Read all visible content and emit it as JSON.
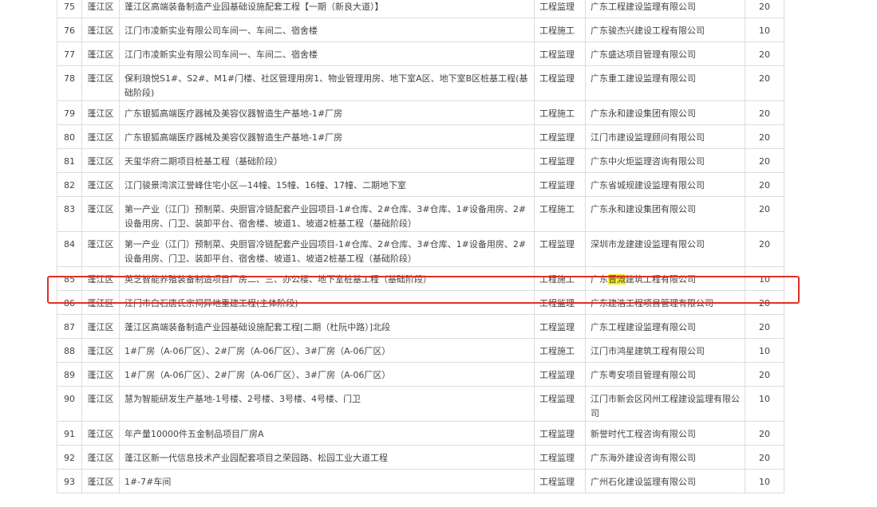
{
  "rows": [
    {
      "no": "75",
      "district": "蓬江区",
      "project": "蓬江区高端装备制造产业园基础设施配套工程【一期（新良大道）】",
      "type": "工程监理",
      "company": "广东工程建设监理有限公司",
      "score": "20"
    },
    {
      "no": "76",
      "district": "蓬江区",
      "project": "江门市凌新实业有限公司车间一、车间二、宿舍楼",
      "type": "工程施工",
      "company": "广东骏杰兴建设工程有限公司",
      "score": "10"
    },
    {
      "no": "77",
      "district": "蓬江区",
      "project": "江门市凌新实业有限公司车间一、车间二、宿舍楼",
      "type": "工程监理",
      "company": "广东盛达项目管理有限公司",
      "score": "20"
    },
    {
      "no": "78",
      "district": "蓬江区",
      "project": "保利琅悦S1#、S2#、M1#门楼、社区管理用房1、物业管理用房、地下室A区、地下室B区桩基工程(基础阶段)",
      "type": "工程监理",
      "company": "广东重工建设监理有限公司",
      "score": "20"
    },
    {
      "no": "79",
      "district": "蓬江区",
      "project": "广东银狐高端医疗器械及美容仪器智造生产基地-1#厂房",
      "type": "工程施工",
      "company": "广东永和建设集团有限公司",
      "score": "20"
    },
    {
      "no": "80",
      "district": "蓬江区",
      "project": "广东银狐高端医疗器械及美容仪器智造生产基地-1#厂房",
      "type": "工程监理",
      "company": "江门市建设监理顾问有限公司",
      "score": "20"
    },
    {
      "no": "81",
      "district": "蓬江区",
      "project": "天玺华府二期项目桩基工程（基础阶段）",
      "type": "工程监理",
      "company": "广东中火炬监理咨询有限公司",
      "score": "20"
    },
    {
      "no": "82",
      "district": "蓬江区",
      "project": "江门骏景湾滨江誉峰住宅小区—14幢、15幢、16幢、17幢、二期地下室",
      "type": "工程监理",
      "company": "广东省城规建设监理有限公司",
      "score": "20"
    },
    {
      "no": "83",
      "district": "蓬江区",
      "project": "第一产业（江门）预制菜、央厨冒冷链配套产业园项目-1#仓库、2#仓库、3#仓库、1#设备用房、2#设备用房、门卫、装卸平台、宿舍楼、坡道1、坡道2桩基工程（基础阶段）",
      "type": "工程施工",
      "company": "广东永和建设集团有限公司",
      "score": "20"
    },
    {
      "no": "84",
      "district": "蓬江区",
      "project": "第一产业（江门）预制菜、央厨冒冷链配套产业园项目-1#仓库、2#仓库、3#仓库、1#设备用房、2#设备用房、门卫、装卸平台、宿舍楼、坡道1、坡道2桩基工程（基础阶段）",
      "type": "工程监理",
      "company": "深圳市龙建建设监理有限公司",
      "score": "20"
    },
    {
      "no": "85",
      "district": "蓬江区",
      "project": "英芝智能养殖装备制造项目厂房二、三、办公楼、地下室桩基工程（基础阶段）",
      "type": "工程施工",
      "company_pre": "广东",
      "company_hl": "晋溦",
      "company_post": "建筑工程有限公司",
      "score": "10"
    },
    {
      "no": "86",
      "district": "蓬江区",
      "project": "江门市白石唐氏宗祠异地重建工程(主体阶段)",
      "type": "工程监理",
      "company": "广东建浩工程项目管理有限公司",
      "score": "20"
    },
    {
      "no": "87",
      "district": "蓬江区",
      "project": "蓬江区高端装备制造产业园基础设施配套工程[二期（杜阮中路）]北段",
      "type": "工程监理",
      "company": "广东工程建设监理有限公司",
      "score": "20"
    },
    {
      "no": "88",
      "district": "蓬江区",
      "project": "1#厂房（A-06厂区）、2#厂房（A-06厂区）、3#厂房（A-06厂区）",
      "type": "工程施工",
      "company": "江门市鸿星建筑工程有限公司",
      "score": "10"
    },
    {
      "no": "89",
      "district": "蓬江区",
      "project": "1#厂房（A-06厂区）、2#厂房（A-06厂区）、3#厂房（A-06厂区）",
      "type": "工程监理",
      "company": "广东粤安项目管理有限公司",
      "score": "20"
    },
    {
      "no": "90",
      "district": "蓬江区",
      "project": "慧为智能研发生产基地-1号楼、2号楼、3号楼、4号楼、门卫",
      "type": "工程监理",
      "company": "江门市新会区冈州工程建设监理有限公司",
      "score": "10"
    },
    {
      "no": "91",
      "district": "蓬江区",
      "project": "年产量10000件五金制品项目厂房A",
      "type": "工程监理",
      "company": "新誉时代工程咨询有限公司",
      "score": "20"
    },
    {
      "no": "92",
      "district": "蓬江区",
      "project": "蓬江区新一代信息技术产业园配套项目之荣园路、松园工业大道工程",
      "type": "工程监理",
      "company": "广东海外建设咨询有限公司",
      "score": "20"
    },
    {
      "no": "93",
      "district": "蓬江区",
      "project": "1#-7#车间",
      "type": "工程监理",
      "company": "广州石化建设监理有限公司",
      "score": "10"
    }
  ]
}
